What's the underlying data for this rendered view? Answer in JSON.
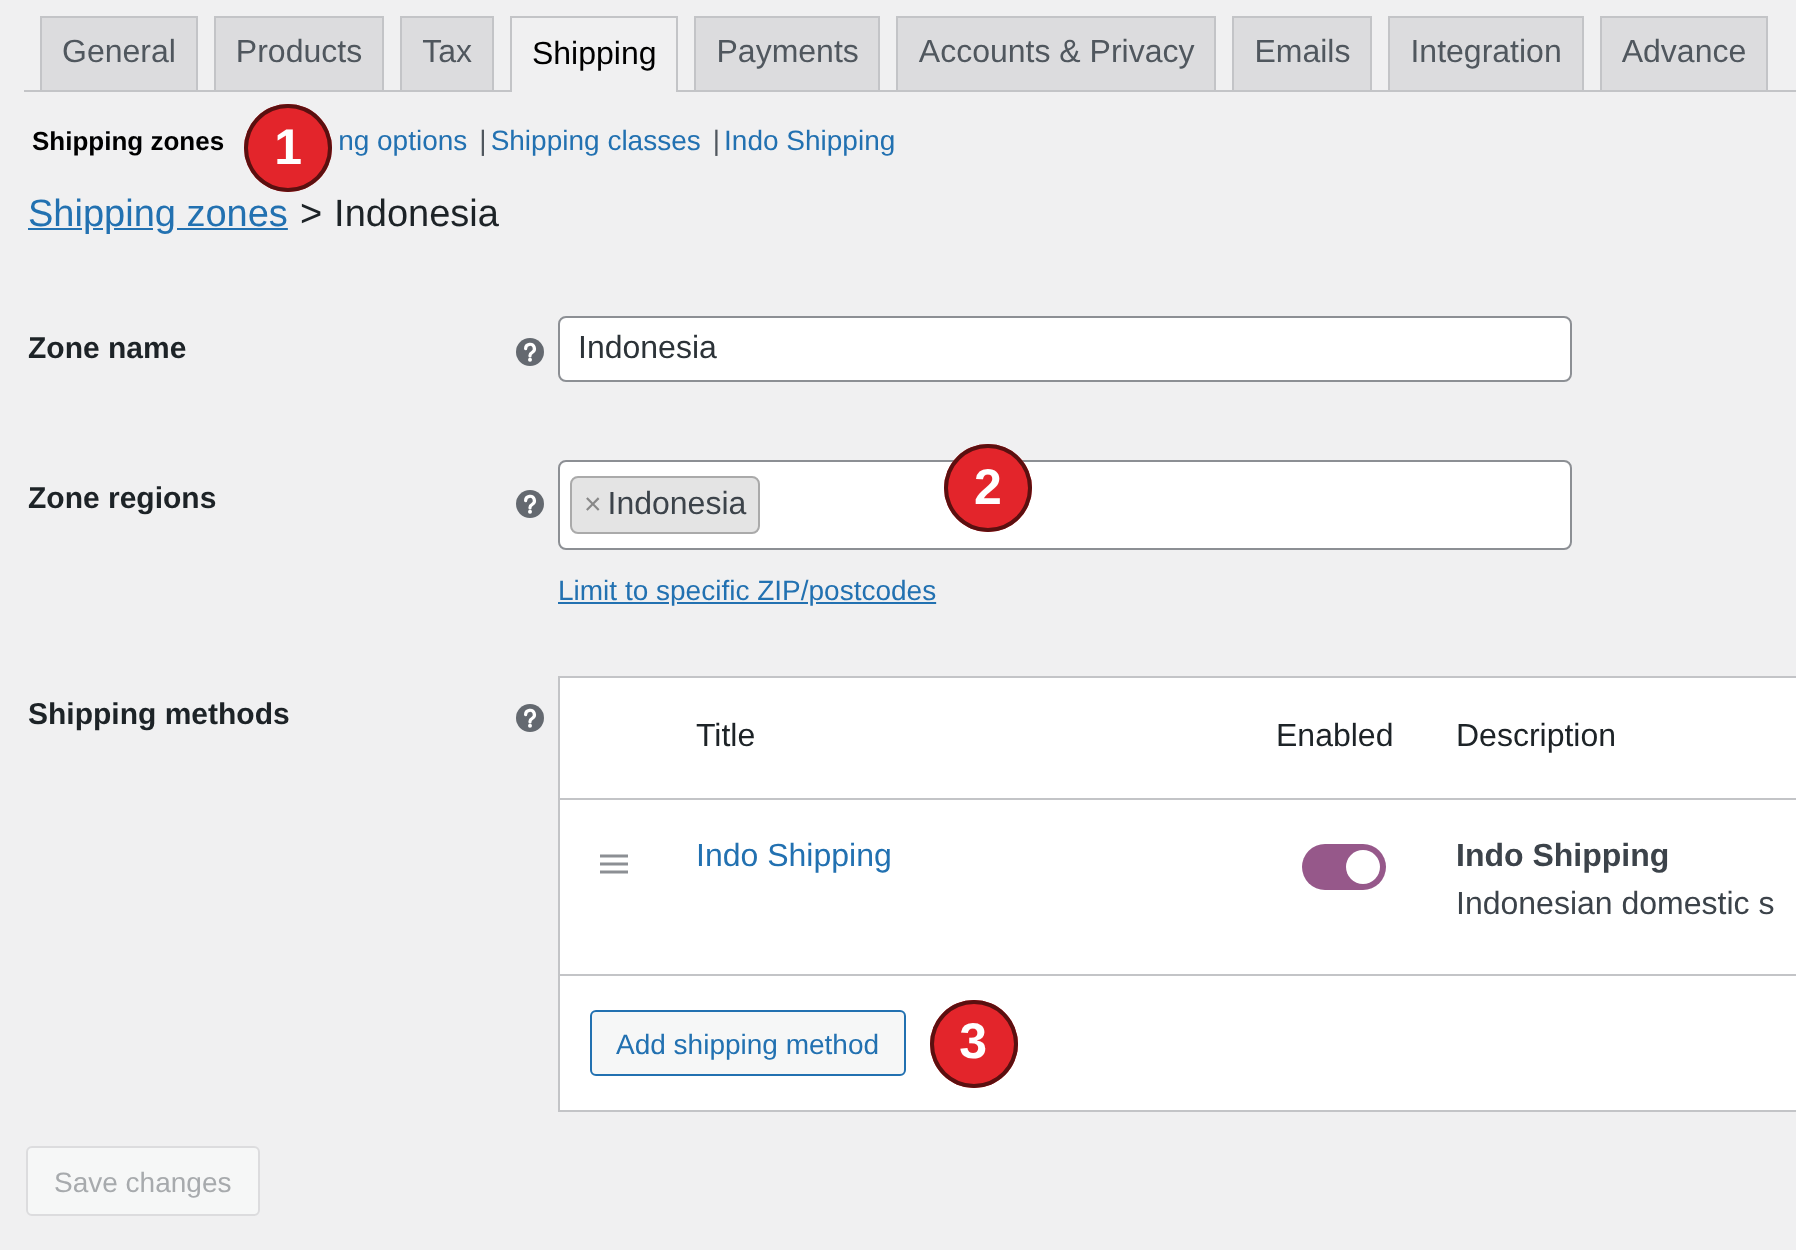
{
  "tabs": [
    {
      "label": "General",
      "selected": false
    },
    {
      "label": "Products",
      "selected": false
    },
    {
      "label": "Tax",
      "selected": false
    },
    {
      "label": "Shipping",
      "selected": true
    },
    {
      "label": "Payments",
      "selected": false
    },
    {
      "label": "Accounts & Privacy",
      "selected": false
    },
    {
      "label": "Emails",
      "selected": false
    },
    {
      "label": "Integration",
      "selected": false
    },
    {
      "label": "Advance",
      "selected": false
    }
  ],
  "subnav": [
    {
      "label": "Shipping zones",
      "selected": true
    },
    {
      "label": "ng options",
      "selected": false
    },
    {
      "label": "Shipping classes",
      "selected": false,
      "separator": "|"
    },
    {
      "label": "Indo Shipping",
      "selected": false,
      "separator": "|"
    }
  ],
  "breadcrumb": {
    "link": "Shipping zones",
    "separator": ">",
    "current": "Indonesia"
  },
  "zone_name": {
    "label": "Zone name",
    "value": "Indonesia"
  },
  "zone_regions": {
    "label": "Zone regions",
    "tags": [
      {
        "remove": "×",
        "label": "Indonesia"
      }
    ],
    "link": "Limit to specific ZIP/postcodes"
  },
  "shipping_methods": {
    "label": "Shipping methods",
    "columns": [
      "Title",
      "Enabled",
      "Description"
    ],
    "rows": [
      {
        "title": "Indo Shipping",
        "enabled": true,
        "description_title": "Indo Shipping",
        "description": "Indonesian domestic s"
      }
    ],
    "add_button": "Add shipping method"
  },
  "save_button": {
    "label": "Save changes",
    "disabled": true
  },
  "annotations": [
    {
      "label": "1"
    },
    {
      "label": "2"
    },
    {
      "label": "3"
    }
  ]
}
